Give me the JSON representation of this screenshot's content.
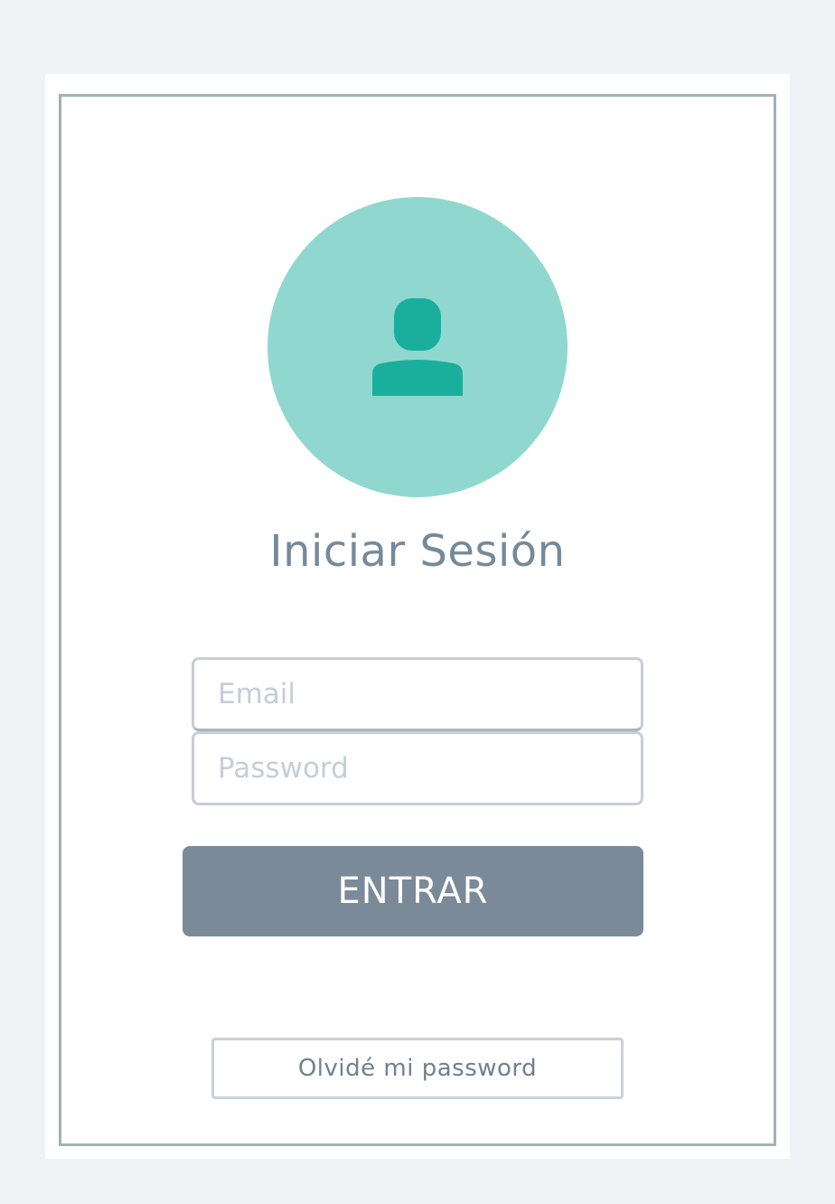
{
  "login": {
    "title": "Iniciar Sesión",
    "email_placeholder": "Email",
    "email_value": "",
    "password_placeholder": "Password",
    "password_value": "",
    "submit_label": "ENTRAR",
    "forgot_label": "Olvidé mi password"
  },
  "icons": {
    "avatar": "user-icon"
  },
  "colors": {
    "page_background": "#eff3f6",
    "avatar_circle": "#90d8cf",
    "avatar_icon": "#1aaf9d",
    "title_text": "#768999",
    "submit_button": "#7b8a98",
    "frame_border": "#a2b1ba"
  }
}
